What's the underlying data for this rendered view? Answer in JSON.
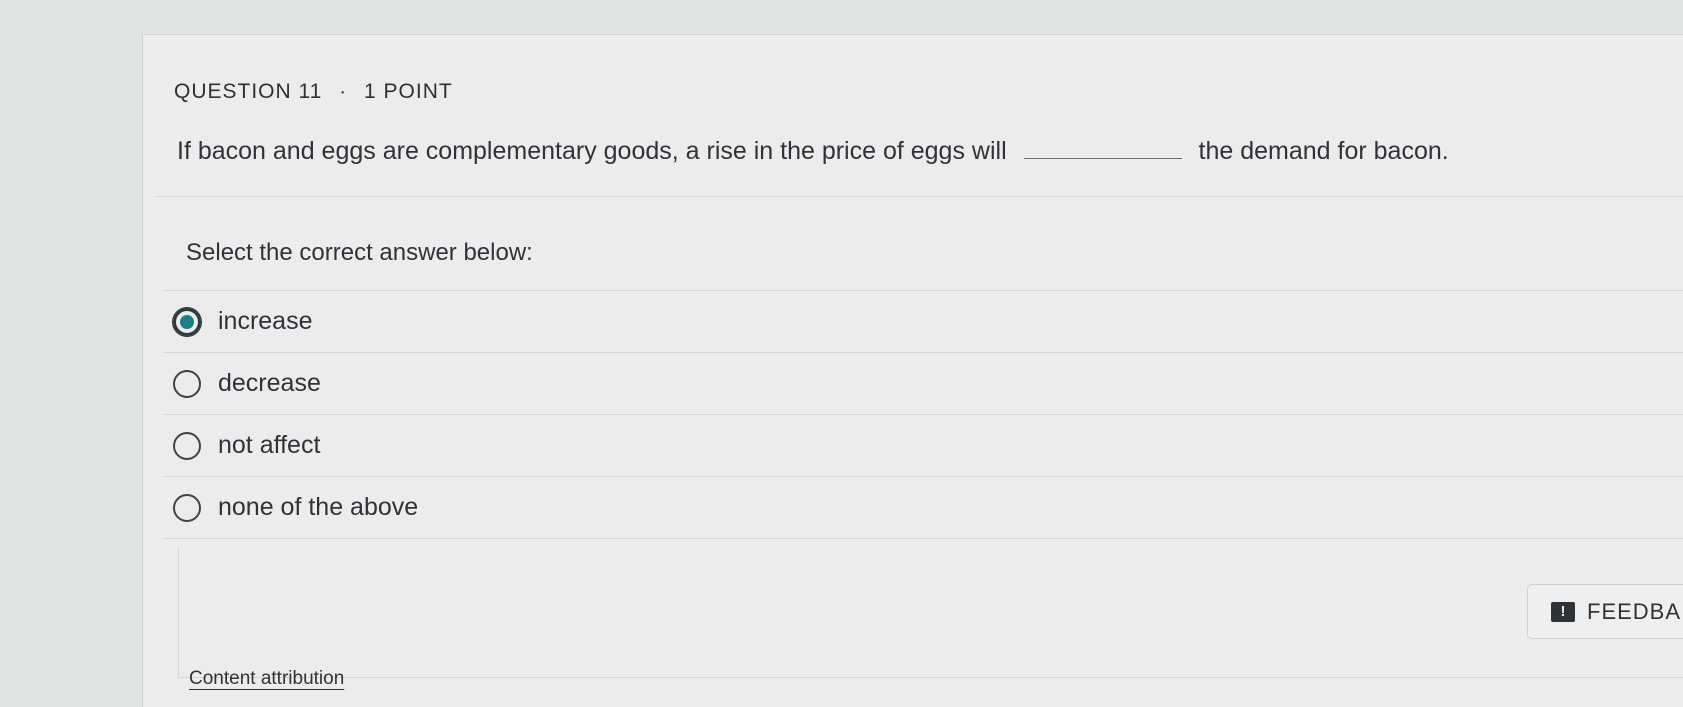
{
  "question": {
    "number_label": "QUESTION 11",
    "separator": "·",
    "points_label": "1 POINT",
    "text_before_blank": "If bacon and eggs are complementary goods, a rise in the price of eggs will",
    "text_after_blank": "the demand for bacon."
  },
  "answer_prompt": "Select the correct answer below:",
  "options": [
    {
      "label": "increase",
      "selected": true
    },
    {
      "label": "decrease",
      "selected": false
    },
    {
      "label": "not affect",
      "selected": false
    },
    {
      "label": "none of the above",
      "selected": false
    }
  ],
  "feedback": {
    "icon": "alert-icon",
    "icon_glyph": "!",
    "label": "FEEDBA"
  },
  "attribution_link": "Content attribution",
  "colors": {
    "accent": "#1f7f86",
    "background": "#ececec",
    "text": "#2f3337"
  }
}
